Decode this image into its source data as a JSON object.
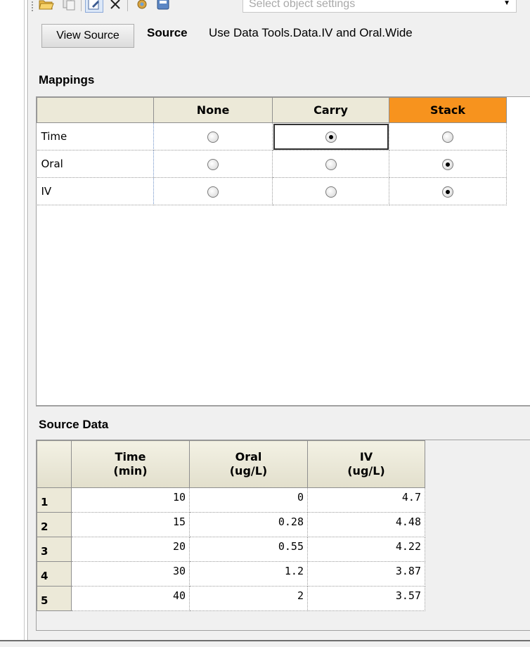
{
  "toolbar": {
    "buttons": [
      {
        "icon": "open-folder-icon"
      },
      {
        "icon": "copy-icon"
      },
      {
        "icon": "edit-icon"
      },
      {
        "icon": "delete-x-icon"
      },
      {
        "icon": "settings-gear-icon"
      },
      {
        "icon": "save-settings-icon"
      }
    ],
    "settings_placeholder": "Select object settings"
  },
  "source": {
    "view_button_label": "View Source",
    "label": "Source",
    "value": "Use Data Tools.Data.IV and Oral.Wide"
  },
  "mappings": {
    "title": "Mappings",
    "columns": [
      "None",
      "Carry",
      "Stack"
    ],
    "highlight_column": "Stack",
    "rows": [
      {
        "label": "Time",
        "selected": "Carry"
      },
      {
        "label": "Oral",
        "selected": "Stack"
      },
      {
        "label": "IV",
        "selected": "Stack"
      }
    ]
  },
  "source_data": {
    "title": "Source Data",
    "columns": [
      {
        "name": "Time",
        "unit": "(min)"
      },
      {
        "name": "Oral",
        "unit": "(ug/L)"
      },
      {
        "name": "IV",
        "unit": "(ug/L)"
      }
    ],
    "rows": [
      {
        "index": "1",
        "values": [
          "10",
          "0",
          "4.7"
        ]
      },
      {
        "index": "2",
        "values": [
          "15",
          "0.28",
          "4.48"
        ]
      },
      {
        "index": "3",
        "values": [
          "20",
          "0.55",
          "4.22"
        ]
      },
      {
        "index": "4",
        "values": [
          "30",
          "1.2",
          "3.87"
        ]
      },
      {
        "index": "5",
        "values": [
          "40",
          "2",
          "3.57"
        ]
      }
    ]
  },
  "colors": {
    "stack_header": "#f7931e",
    "grid_header": "#ece9d8",
    "panel_background": "#f0f0f0"
  }
}
